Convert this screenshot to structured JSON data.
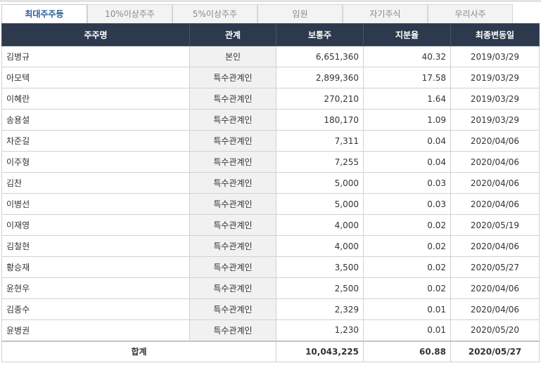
{
  "tabs": [
    {
      "label": "최대주주등",
      "active": true
    },
    {
      "label": "10%이상주주",
      "active": false
    },
    {
      "label": "5%이상주주",
      "active": false
    },
    {
      "label": "임원",
      "active": false
    },
    {
      "label": "자기주식",
      "active": false
    },
    {
      "label": "우리사주",
      "active": false
    }
  ],
  "table": {
    "headers": {
      "name": "주주명",
      "relation": "관계",
      "shares": "보통주",
      "ratio": "지분율",
      "date": "최종변동일"
    },
    "rows": [
      {
        "name": "김병규",
        "relation": "본인",
        "shares": "6,651,360",
        "ratio": "40.32",
        "date": "2019/03/29"
      },
      {
        "name": "아모텍",
        "relation": "특수관계인",
        "shares": "2,899,360",
        "ratio": "17.58",
        "date": "2019/03/29"
      },
      {
        "name": "이혜란",
        "relation": "특수관계인",
        "shares": "270,210",
        "ratio": "1.64",
        "date": "2019/03/29"
      },
      {
        "name": "송용설",
        "relation": "특수관계인",
        "shares": "180,170",
        "ratio": "1.09",
        "date": "2019/03/29"
      },
      {
        "name": "차준길",
        "relation": "특수관계인",
        "shares": "7,311",
        "ratio": "0.04",
        "date": "2020/04/06"
      },
      {
        "name": "이주형",
        "relation": "특수관계인",
        "shares": "7,255",
        "ratio": "0.04",
        "date": "2020/04/06"
      },
      {
        "name": "김찬",
        "relation": "특수관계인",
        "shares": "5,000",
        "ratio": "0.03",
        "date": "2020/04/06"
      },
      {
        "name": "이병선",
        "relation": "특수관계인",
        "shares": "5,000",
        "ratio": "0.03",
        "date": "2020/04/06"
      },
      {
        "name": "이재영",
        "relation": "특수관계인",
        "shares": "4,000",
        "ratio": "0.02",
        "date": "2020/05/19"
      },
      {
        "name": "김철현",
        "relation": "특수관계인",
        "shares": "4,000",
        "ratio": "0.02",
        "date": "2020/04/06"
      },
      {
        "name": "황승재",
        "relation": "특수관계인",
        "shares": "3,500",
        "ratio": "0.02",
        "date": "2020/05/27"
      },
      {
        "name": "윤현우",
        "relation": "특수관계인",
        "shares": "2,500",
        "ratio": "0.02",
        "date": "2020/04/06"
      },
      {
        "name": "김종수",
        "relation": "특수관계인",
        "shares": "2,329",
        "ratio": "0.01",
        "date": "2020/04/06"
      },
      {
        "name": "윤병권",
        "relation": "특수관계인",
        "shares": "1,230",
        "ratio": "0.01",
        "date": "2020/05/20"
      }
    ],
    "total": {
      "label": "합계",
      "shares": "10,043,225",
      "ratio": "60.88",
      "date": "2020/05/27"
    }
  }
}
